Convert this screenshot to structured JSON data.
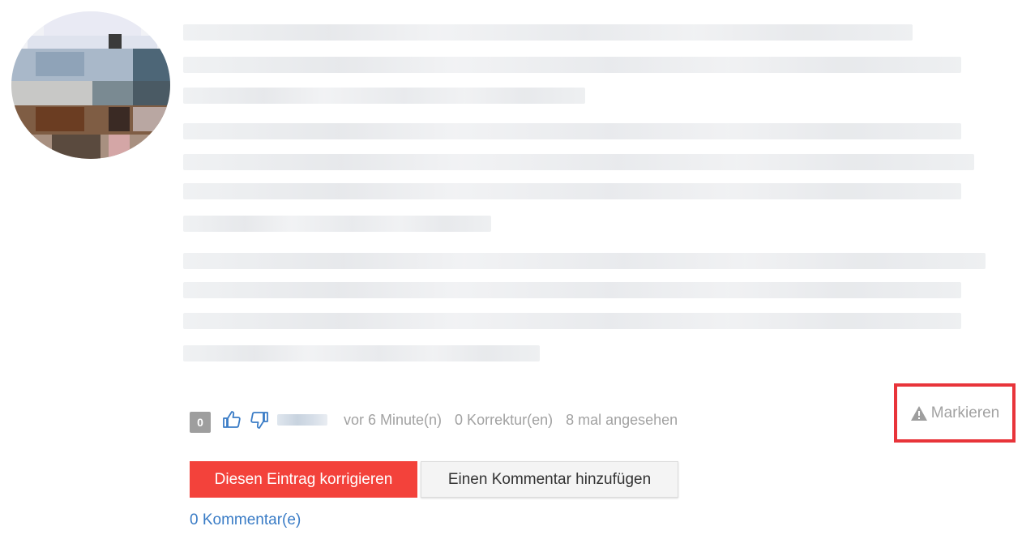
{
  "avatar": {
    "description_icon": "user-avatar"
  },
  "post": {
    "blurred_text_lines": 14
  },
  "meta": {
    "vote_count": "0",
    "thumbs_up_icon": "thumbs-up-icon",
    "thumbs_down_icon": "thumbs-down-icon",
    "time_ago": "vor 6 Minute(n)",
    "corrections": "0 Korrektur(en)",
    "views": "8 mal angesehen"
  },
  "flag": {
    "label": "Markieren",
    "icon": "warning-icon",
    "highlight_color": "#e8343a"
  },
  "actions": {
    "correct_label": "Diesen Eintrag korrigieren",
    "comment_label": "Einen Kommentar hinzufügen",
    "primary_color": "#f3423b"
  },
  "comments": {
    "link_label": "0 Kommentar(e)",
    "link_color": "#3a7cc6"
  }
}
